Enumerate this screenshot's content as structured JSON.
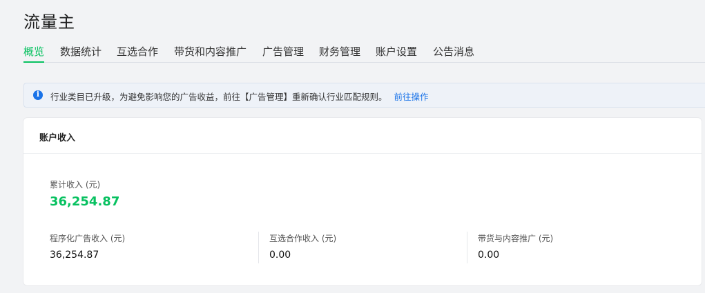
{
  "page": {
    "title": "流量主"
  },
  "tabs": [
    {
      "label": "概览",
      "active": true
    },
    {
      "label": "数据统计"
    },
    {
      "label": "互选合作"
    },
    {
      "label": "带货和内容推广"
    },
    {
      "label": "广告管理"
    },
    {
      "label": "财务管理"
    },
    {
      "label": "账户设置"
    },
    {
      "label": "公告消息"
    }
  ],
  "notice": {
    "icon": "info-icon",
    "text": "行业类目已升级，为避免影响您的广告收益，前往【广告管理】重新确认行业匹配规则。",
    "link": "前往操作"
  },
  "account_income": {
    "title": "账户收入",
    "total": {
      "label": "累计收入 (元)",
      "value": "36,254.87"
    },
    "breakdown": [
      {
        "label": "程序化广告收入 (元)",
        "value": "36,254.87"
      },
      {
        "label": "互选合作收入 (元)",
        "value": "0.00"
      },
      {
        "label": "带货与内容推广 (元)",
        "value": "0.00"
      }
    ]
  },
  "colors": {
    "accent": "#07c160",
    "link": "#1a73e8"
  }
}
